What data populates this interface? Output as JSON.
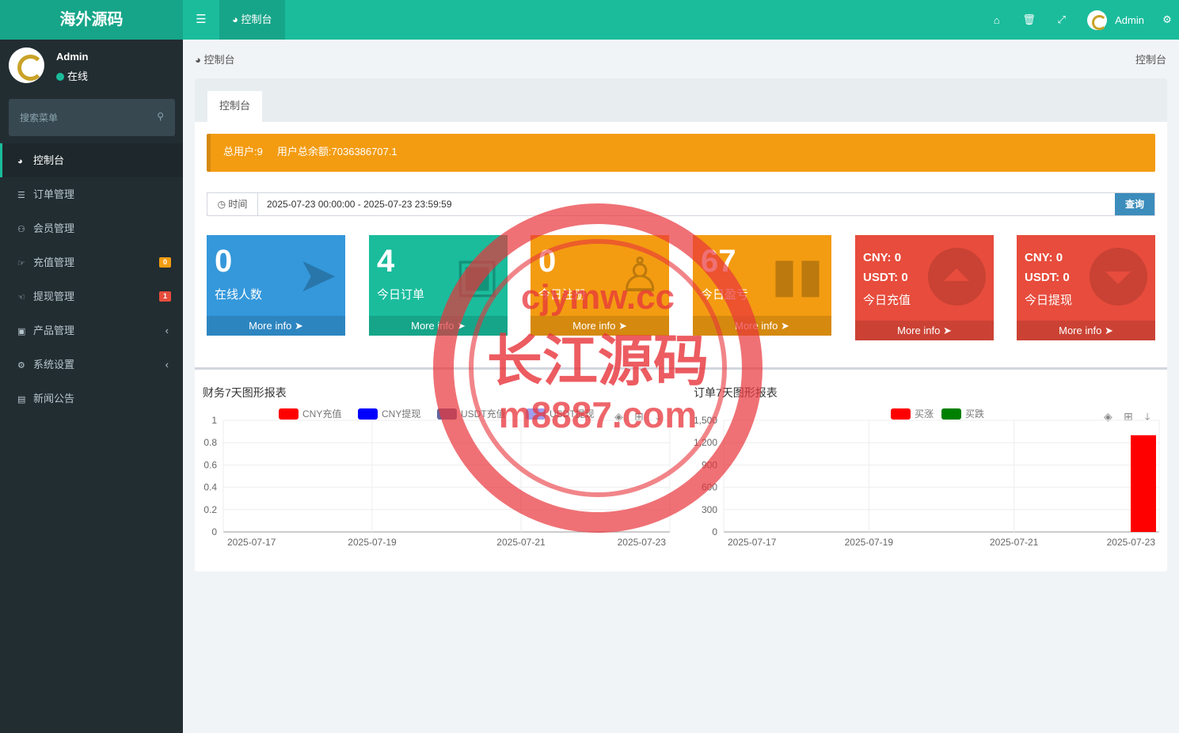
{
  "brand": "海外源码",
  "topbar": {
    "tab_label": "控制台",
    "user_name": "Admin"
  },
  "sidebar": {
    "user": {
      "name": "Admin",
      "status": "在线"
    },
    "search_placeholder": "搜索菜单",
    "items": [
      {
        "label": "控制台",
        "icon": "dashboard-icon",
        "active": true
      },
      {
        "label": "订单管理",
        "icon": "list-icon"
      },
      {
        "label": "会员管理",
        "icon": "users-icon"
      },
      {
        "label": "充值管理",
        "icon": "hand-icon",
        "badge": "0",
        "badge_color": "#f39c12"
      },
      {
        "label": "提现管理",
        "icon": "hand-icon",
        "badge": "1",
        "badge_color": "#e74c3c"
      },
      {
        "label": "产品管理",
        "icon": "shopping-bag-icon",
        "chevron": true
      },
      {
        "label": "系统设置",
        "icon": "gears-icon",
        "chevron": true
      },
      {
        "label": "新闻公告",
        "icon": "newspaper-icon"
      }
    ]
  },
  "breadcrumb": {
    "left": "控制台",
    "right": "控制台"
  },
  "panel": {
    "tab": "控制台",
    "alert": {
      "total_users": "总用户:9",
      "total_balance": "用户总余额:7036386707.1"
    },
    "filter": {
      "label": "时间",
      "value": "2025-07-23 00:00:00 - 2025-07-23 23:59:59",
      "button": "查询"
    },
    "stats": [
      {
        "value": "0",
        "label": "在线人数",
        "more": "More info",
        "color": "#3498db"
      },
      {
        "value": "4",
        "label": "今日订单",
        "more": "More info",
        "color": "#1abc9c"
      },
      {
        "value": "0",
        "label": "今日注册",
        "more": "More info",
        "color": "#f39c12"
      },
      {
        "value": "67",
        "label": "今日盈亏",
        "more": "More info",
        "color": "#f39c12"
      }
    ],
    "money": [
      {
        "cny": "CNY:  0",
        "usdt": "USDT:  0",
        "label": "今日充值",
        "more": "More info"
      },
      {
        "cny": "CNY:  0",
        "usdt": "USDT:  0",
        "label": "今日提现",
        "more": "More info"
      }
    ]
  },
  "chart_data": [
    {
      "type": "line",
      "title": "财务7天图形报表",
      "x": [
        "2025-07-17",
        "2025-07-18",
        "2025-07-19",
        "2025-07-20",
        "2025-07-21",
        "2025-07-22",
        "2025-07-23"
      ],
      "xticks": [
        "2025-07-17",
        "2025-07-19",
        "2025-07-21",
        "2025-07-23"
      ],
      "ylim": [
        0,
        1
      ],
      "yticks": [
        "0",
        "0.2",
        "0.4",
        "0.6",
        "0.8",
        "1"
      ],
      "series": [
        {
          "name": "CNY充值",
          "color": "#ff0000",
          "values": [
            0,
            0,
            0,
            0,
            0,
            0,
            0
          ]
        },
        {
          "name": "CNY提现",
          "color": "#0000ff",
          "values": [
            0,
            0,
            0,
            0,
            0,
            0,
            0
          ]
        },
        {
          "name": "USDT充值",
          "color": "#61649f",
          "values": [
            0,
            0,
            0,
            0,
            0,
            0,
            0
          ]
        },
        {
          "name": "USDT提现",
          "color": "#9f9fef",
          "values": [
            0,
            0,
            0,
            0,
            0,
            0,
            0
          ]
        }
      ],
      "legend": "top-center",
      "grid": true
    },
    {
      "type": "bar",
      "title": "订单7天图形报表",
      "x": [
        "2025-07-17",
        "2025-07-18",
        "2025-07-19",
        "2025-07-20",
        "2025-07-21",
        "2025-07-22",
        "2025-07-23"
      ],
      "xticks": [
        "2025-07-17",
        "2025-07-19",
        "2025-07-21",
        "2025-07-23"
      ],
      "ylim": [
        0,
        1500
      ],
      "yticks": [
        "0",
        "300",
        "600",
        "900",
        "1,200",
        "1,500"
      ],
      "series": [
        {
          "name": "买涨",
          "color": "#ff0000",
          "values": [
            0,
            0,
            0,
            0,
            0,
            0,
            1300
          ]
        },
        {
          "name": "买跌",
          "color": "#008000",
          "values": [
            0,
            0,
            0,
            0,
            0,
            0,
            0
          ]
        }
      ],
      "legend": "top-center",
      "grid": true
    }
  ],
  "watermark": {
    "line1": "cjymw.cc",
    "line2": "长江源码",
    "line3": "m8887.com"
  }
}
